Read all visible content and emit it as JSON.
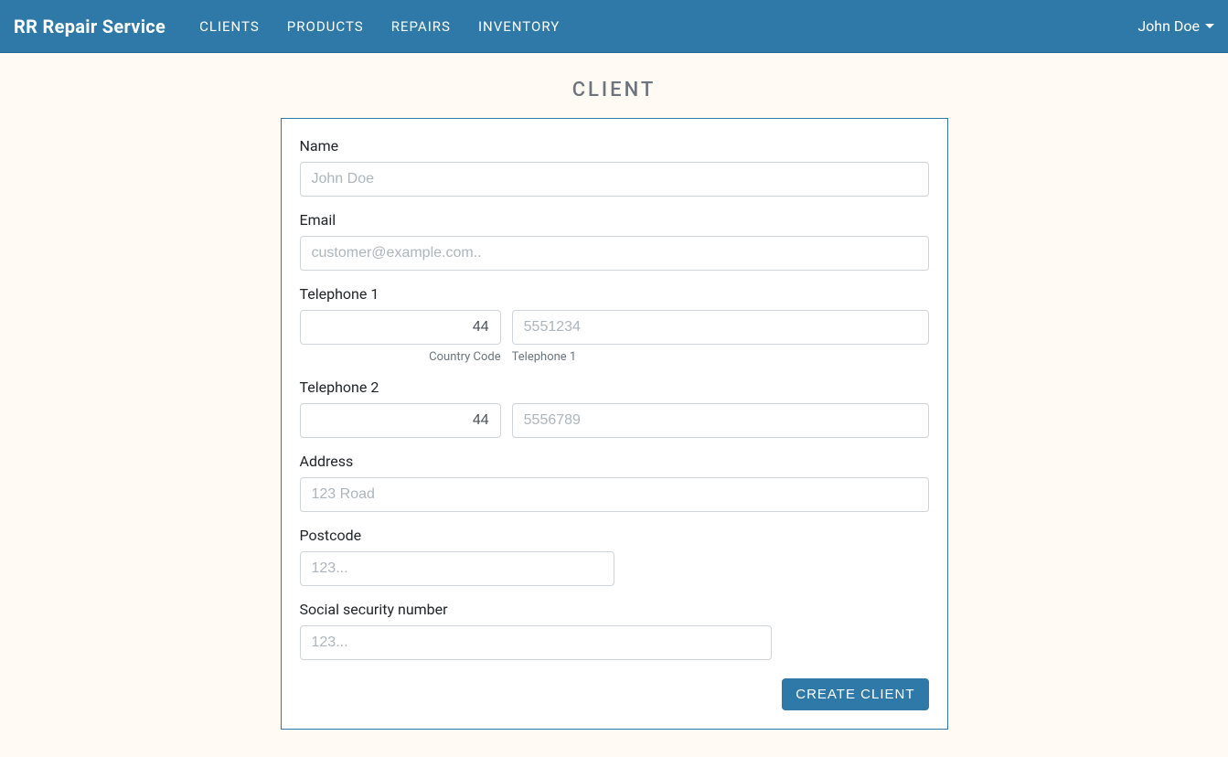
{
  "navbar": {
    "brand": "RR Repair Service",
    "items": [
      {
        "label": "Clients"
      },
      {
        "label": "Products"
      },
      {
        "label": "Repairs"
      },
      {
        "label": "Inventory"
      }
    ],
    "user": "John Doe"
  },
  "page": {
    "title": "Client"
  },
  "form": {
    "name_label": "Name",
    "name_placeholder": "John Doe",
    "email_label": "Email",
    "email_placeholder": "customer@example.com..",
    "tel1_label": "Telephone 1",
    "tel1_cc_value": "44",
    "tel1_cc_sublabel": "Country Code",
    "tel1_num_placeholder": "5551234",
    "tel1_num_sublabel": "Telephone 1",
    "tel2_label": "Telephone 2",
    "tel2_cc_value": "44",
    "tel2_num_placeholder": "5556789",
    "address_label": "Address",
    "address_placeholder": "123 Road",
    "postcode_label": "Postcode",
    "postcode_placeholder": "123...",
    "ssn_label": "Social security number",
    "ssn_placeholder": "123...",
    "submit_label": "Create Client"
  }
}
